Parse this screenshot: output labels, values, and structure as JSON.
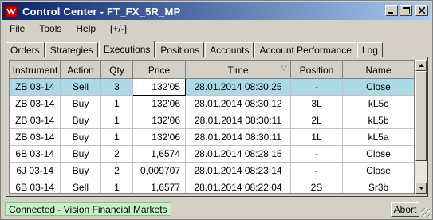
{
  "window": {
    "title": "Control Center - FT_FX_5R_MP",
    "app_icon": "vision-logo-icon",
    "controls": {
      "minimize": "_",
      "maximize": "□",
      "close": "×"
    }
  },
  "menu": {
    "items": [
      "File",
      "Tools",
      "Help",
      "[+/-]"
    ]
  },
  "tabs": {
    "items": [
      "Orders",
      "Strategies",
      "Executions",
      "Positions",
      "Accounts",
      "Account Performance",
      "Log"
    ],
    "active": "Executions"
  },
  "grid": {
    "columns": [
      "Instrument",
      "Action",
      "Qty",
      "Price",
      "Time",
      "Position",
      "Name"
    ],
    "sorted_column": "Time",
    "sort_indicator": "▽",
    "rows": [
      {
        "instrument": "ZB 03-14",
        "action": "Sell",
        "qty": "3",
        "price": "132'05",
        "time": "28.01.2014 08:30:25",
        "position": "-",
        "name": "Close",
        "selected": true
      },
      {
        "instrument": "ZB 03-14",
        "action": "Buy",
        "qty": "1",
        "price": "132'06",
        "time": "28.01.2014 08:30:12",
        "position": "3L",
        "name": "kL5c"
      },
      {
        "instrument": "ZB 03-14",
        "action": "Buy",
        "qty": "1",
        "price": "132'06",
        "time": "28.01.2014 08:30:11",
        "position": "2L",
        "name": "kL5b"
      },
      {
        "instrument": "ZB 03-14",
        "action": "Buy",
        "qty": "1",
        "price": "132'06",
        "time": "28.01.2014 08:30:11",
        "position": "1L",
        "name": "kL5a"
      },
      {
        "instrument": "6B 03-14",
        "action": "Buy",
        "qty": "2",
        "price": "1,6574",
        "time": "28.01.2014 08:28:15",
        "position": "-",
        "name": "Close"
      },
      {
        "instrument": "6J 03-14",
        "action": "Buy",
        "qty": "2",
        "price": "0,009707",
        "time": "28.01.2014 08:23:14",
        "position": "-",
        "name": "Close"
      },
      {
        "instrument": "6B 03-14",
        "action": "Sell",
        "qty": "1",
        "price": "1,6577",
        "time": "28.01.2014 08:22:04",
        "position": "2S",
        "name": "Sr3b"
      }
    ]
  },
  "status": {
    "connection": "Connected - Vision Financial Markets",
    "connection_color": "#c7f0c7",
    "abort_label": "Abort"
  },
  "colors": {
    "title_start": "#0a246a",
    "title_end": "#a6caf0",
    "selection": "#add8e6"
  }
}
